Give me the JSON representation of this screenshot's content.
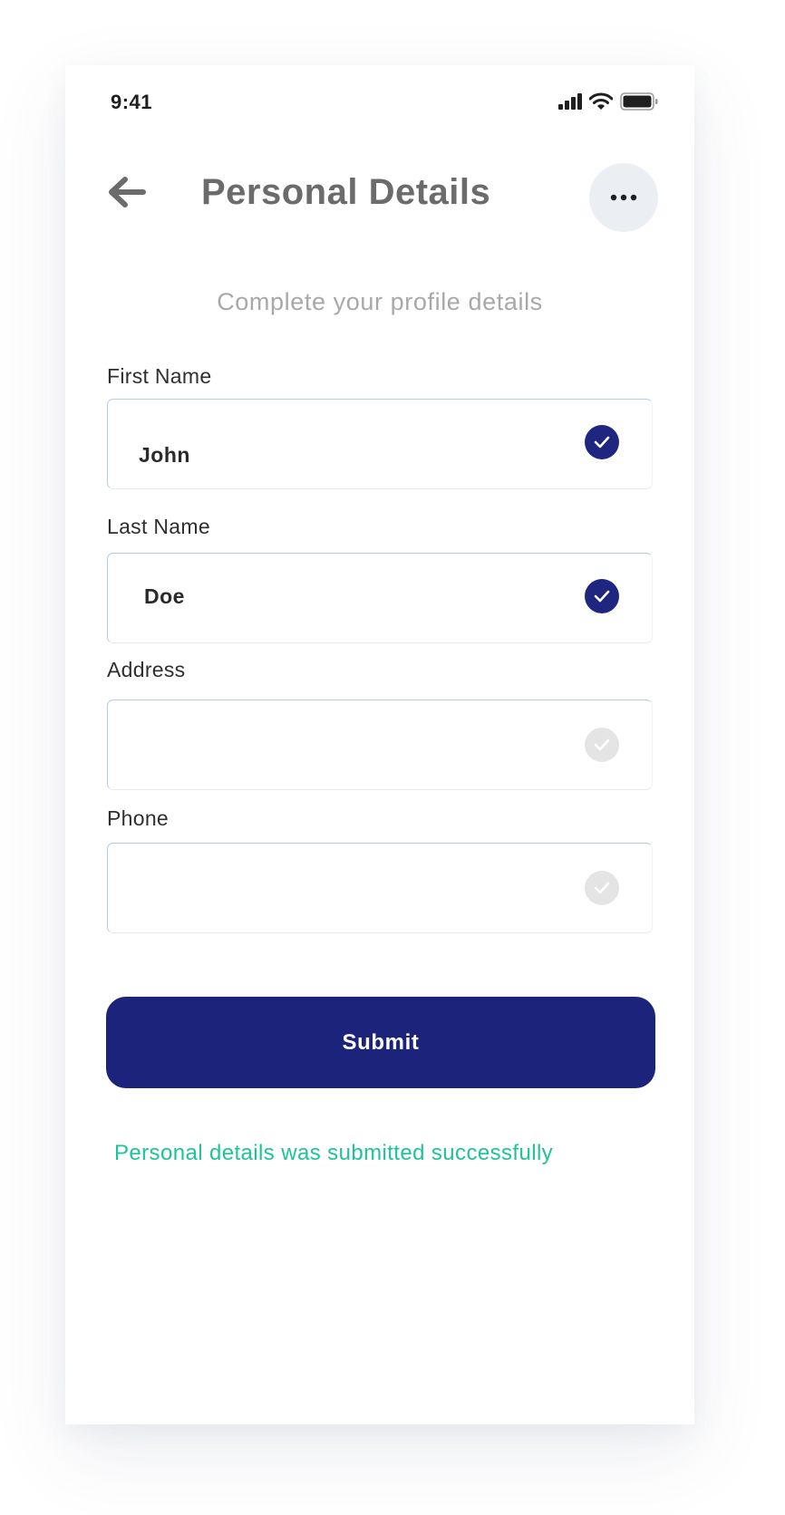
{
  "status_bar": {
    "time": "9:41",
    "signal_icon": "signal-bars-icon",
    "wifi_icon": "wifi-icon",
    "battery_icon": "battery-icon"
  },
  "header": {
    "title": "Personal Details",
    "back_icon": "arrow-left-icon",
    "more_icon": "more-horizontal-icon"
  },
  "subtitle": "Complete your profile details",
  "form": {
    "fields": [
      {
        "label": "First Name",
        "value": "John",
        "status": "checked"
      },
      {
        "label": "Last Name",
        "value": "Doe",
        "status": "checked"
      },
      {
        "label": "Address",
        "value": "",
        "status": "unchecked"
      },
      {
        "label": "Phone",
        "value": "",
        "status": "unchecked"
      }
    ],
    "submit_label": "Submit"
  },
  "success_message": "Personal details was submitted successfully",
  "colors": {
    "primary": "#1c237b",
    "success": "#1fc39a",
    "check_done": "#1e2680",
    "check_pending": "#e4e4e4",
    "title_gray": "#6b6b6b",
    "subtitle_gray": "#a8a8a8"
  }
}
